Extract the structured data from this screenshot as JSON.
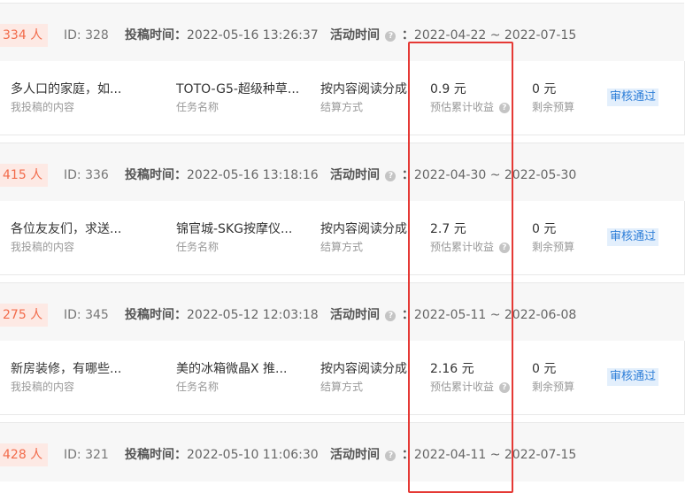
{
  "labels": {
    "submit_time": "投稿时间：",
    "activity_time": "活动时间",
    "activity_colon": "：",
    "my_content": "我投稿的内容",
    "task_name": "任务名称",
    "settle_method": "结算方式",
    "estimated_income": "预估累计收益",
    "remaining_budget": "剩余预算",
    "info_glyph": "?"
  },
  "submissions": [
    {
      "count": "334 人",
      "id": "ID: 328",
      "submit_time": "2022-05-16 13:26:37",
      "activity_range": "2022-04-22 ~ 2022-07-15",
      "content": "多人口的家庭，如...",
      "task": "TOTO-G5-超级种草...",
      "settle": "按内容阅读分成",
      "income": "0.9 元",
      "budget": "0 元",
      "status": "审核通过"
    },
    {
      "count": "415 人",
      "id": "ID: 336",
      "submit_time": "2022-05-16 13:18:16",
      "activity_range": "2022-04-30 ~ 2022-05-30",
      "content": "各位友友们，求送...",
      "task": "锦官城-SKG按摩仪...",
      "settle": "按内容阅读分成",
      "income": "2.7 元",
      "budget": "0 元",
      "status": "审核通过"
    },
    {
      "count": "275 人",
      "id": "ID: 345",
      "submit_time": "2022-05-12 12:03:18",
      "activity_range": "2022-05-11 ~ 2022-06-08",
      "content": "新房装修，有哪些...",
      "task": "美的冰箱微晶X 推...",
      "settle": "按内容阅读分成",
      "income": "2.16 元",
      "budget": "0 元",
      "status": "审核通过"
    },
    {
      "count": "428 人",
      "id": "ID: 321",
      "submit_time": "2022-05-10 11:06:30",
      "activity_range": "2022-04-11 ~ 2022-07-15"
    }
  ]
}
